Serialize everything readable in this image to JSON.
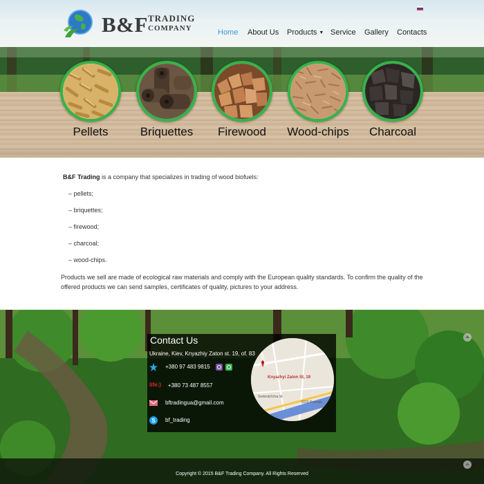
{
  "logo": {
    "name": "B&F",
    "line1": "TRADING",
    "line2": "COMPANY"
  },
  "nav": [
    {
      "label": "Home",
      "active": true
    },
    {
      "label": "About Us"
    },
    {
      "label": "Products",
      "has_dropdown": true
    },
    {
      "label": "Service"
    },
    {
      "label": "Gallery"
    },
    {
      "label": "Contacts"
    }
  ],
  "products": [
    {
      "label": "Pellets"
    },
    {
      "label": "Briquettes"
    },
    {
      "label": "Firewood"
    },
    {
      "label": "Wood-chips"
    },
    {
      "label": "Charcoal"
    }
  ],
  "intro": {
    "brand": "B&F Trading",
    "text": " is a company that specializes in trading of wood biofuels:"
  },
  "items": [
    "– pellets;",
    "– briquettes;",
    "– firewood;",
    "– charcoal;",
    "– wood-chips."
  ],
  "paragraph": "Products we sell are made of ecological raw materials and comply with the European quality standards. To confirm the quality of the offered products we can send samples, certificates of quality, pictures to your address.",
  "contact": {
    "title": "Contact Us",
    "address": "Ukraine, Kiev, Knyazhiy Zaton st. 19, of. 83",
    "phone1": "+380 97 483 9815",
    "phone2": "+380 73 487 8557",
    "email": "bftradingua@gmail.com",
    "skype": "bf_trading",
    "map_label": "Knyazhyi Zaton St, 19",
    "map_street": "Srebrokil's'ka St",
    "map_road": "(323) Pozniak"
  },
  "copyright": "Copyright © 2015 B&F Trading Company. All Rights Reserved",
  "colors": {
    "accent": "#35b34a",
    "nav_active": "#3a9ad8"
  }
}
